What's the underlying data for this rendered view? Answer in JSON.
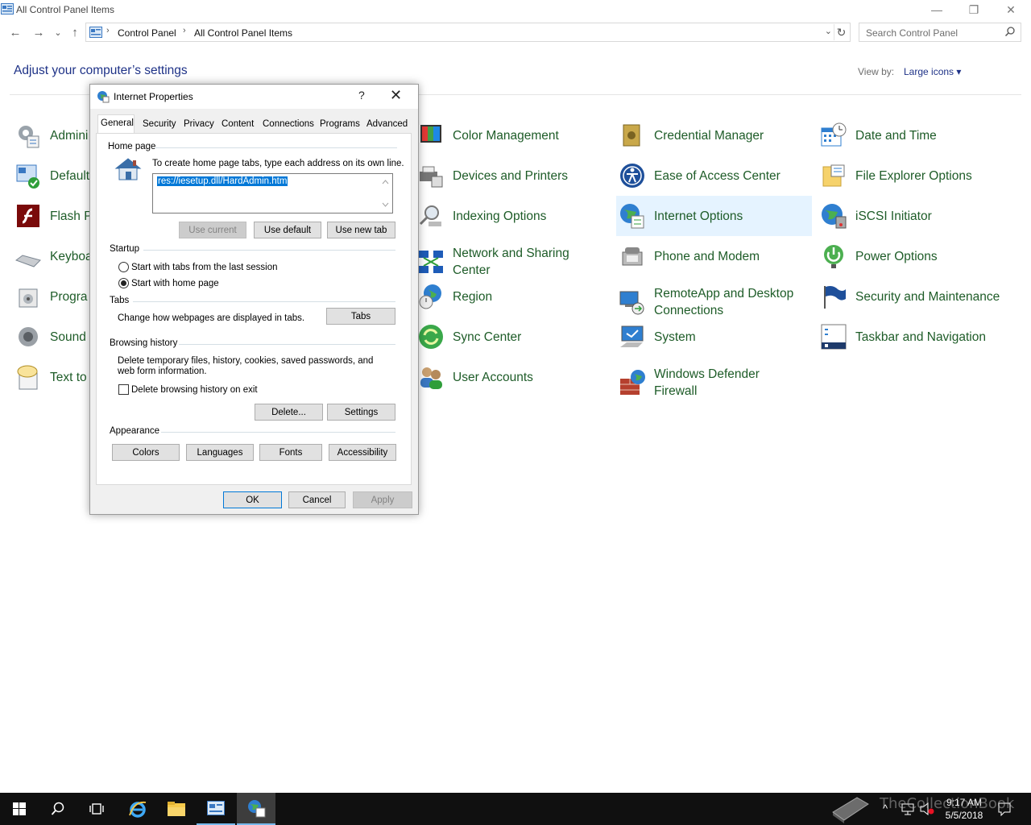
{
  "window": {
    "title": "All Control Panel Items",
    "minimize": "—",
    "maximize": "❐",
    "close": "✕"
  },
  "nav": {
    "back": "←",
    "forward": "→",
    "recent": "⌄",
    "up": "↑",
    "breadcrumb": [
      "Control Panel",
      "All Control Panel Items"
    ],
    "refresh": "↻",
    "search_placeholder": "Search Control Panel"
  },
  "main": {
    "heading": "Adjust your computer’s settings",
    "view_by_label": "View by:",
    "view_by_value": "Large icons ▾"
  },
  "items": [
    {
      "label": "Admini",
      "icon": "admin-tools-icon"
    },
    {
      "label": "Default",
      "icon": "default-programs-icon"
    },
    {
      "label": "Flash P",
      "icon": "flash-player-icon"
    },
    {
      "label": "Keyboa",
      "icon": "keyboard-icon"
    },
    {
      "label": "Progra",
      "icon": "programs-icon"
    },
    {
      "label": "Sound",
      "icon": "sound-icon"
    },
    {
      "label": "Text to S",
      "icon": "speech-icon"
    },
    {
      "label": "Color Management",
      "icon": "color-management-icon"
    },
    {
      "label": "Devices and Printers",
      "icon": "printer-icon"
    },
    {
      "label": "Indexing Options",
      "icon": "indexing-icon"
    },
    {
      "label": "Network and Sharing Center",
      "icon": "network-icon"
    },
    {
      "label": "Region",
      "icon": "region-icon"
    },
    {
      "label": "Sync Center",
      "icon": "sync-icon"
    },
    {
      "label": "User Accounts",
      "icon": "users-icon"
    },
    {
      "label": "Credential Manager",
      "icon": "credential-icon"
    },
    {
      "label": "Ease of Access Center",
      "icon": "ease-of-access-icon"
    },
    {
      "label": "Internet Options",
      "icon": "internet-options-icon"
    },
    {
      "label": "Phone and Modem",
      "icon": "phone-icon"
    },
    {
      "label": "RemoteApp and Desktop Connections",
      "icon": "remoteapp-icon"
    },
    {
      "label": "System",
      "icon": "system-icon"
    },
    {
      "label": "Windows Defender Firewall",
      "icon": "firewall-icon"
    },
    {
      "label": "Date and Time",
      "icon": "calendar-icon"
    },
    {
      "label": "File Explorer Options",
      "icon": "folder-options-icon"
    },
    {
      "label": "iSCSI Initiator",
      "icon": "iscsi-icon"
    },
    {
      "label": "Power Options",
      "icon": "power-icon"
    },
    {
      "label": "Security and Maintenance",
      "icon": "flag-icon"
    },
    {
      "label": "Taskbar and Navigation",
      "icon": "taskbar-icon"
    }
  ],
  "dialog": {
    "title": "Internet Properties",
    "help": "?",
    "close": "✕",
    "tabs": [
      "General",
      "Security",
      "Privacy",
      "Content",
      "Connections",
      "Programs",
      "Advanced"
    ],
    "home_page": {
      "group": "Home page",
      "instructions": "To create home page tabs, type each address on its own line.",
      "value": "res://iesetup.dll/HardAdmin.htm",
      "use_current": "Use current",
      "use_default": "Use default",
      "use_new_tab": "Use new tab"
    },
    "startup": {
      "group": "Startup",
      "option_last_session": "Start with tabs from the last session",
      "option_home_page": "Start with home page",
      "selected": "home_page"
    },
    "tabs_group": {
      "group": "Tabs",
      "text": "Change how webpages are displayed in tabs.",
      "button": "Tabs"
    },
    "browsing_history": {
      "group": "Browsing history",
      "text": "Delete temporary files, history, cookies, saved passwords, and web form information.",
      "checkbox": "Delete browsing history on exit",
      "checked": false,
      "delete": "Delete...",
      "settings": "Settings"
    },
    "appearance": {
      "group": "Appearance",
      "colors": "Colors",
      "languages": "Languages",
      "fonts": "Fonts",
      "accessibility": "Accessibility"
    },
    "ok": "OK",
    "cancel": "Cancel",
    "apply": "Apply"
  },
  "taskbar": {
    "clock_time": "9:17 AM",
    "clock_date": "5/5/2018",
    "watermark": "TheCollectionBook"
  },
  "colors": {
    "link_green": "#1e5c28",
    "heading_blue": "#1e3287",
    "selection": "#0078d7",
    "highlight": "#e5f3ff"
  }
}
